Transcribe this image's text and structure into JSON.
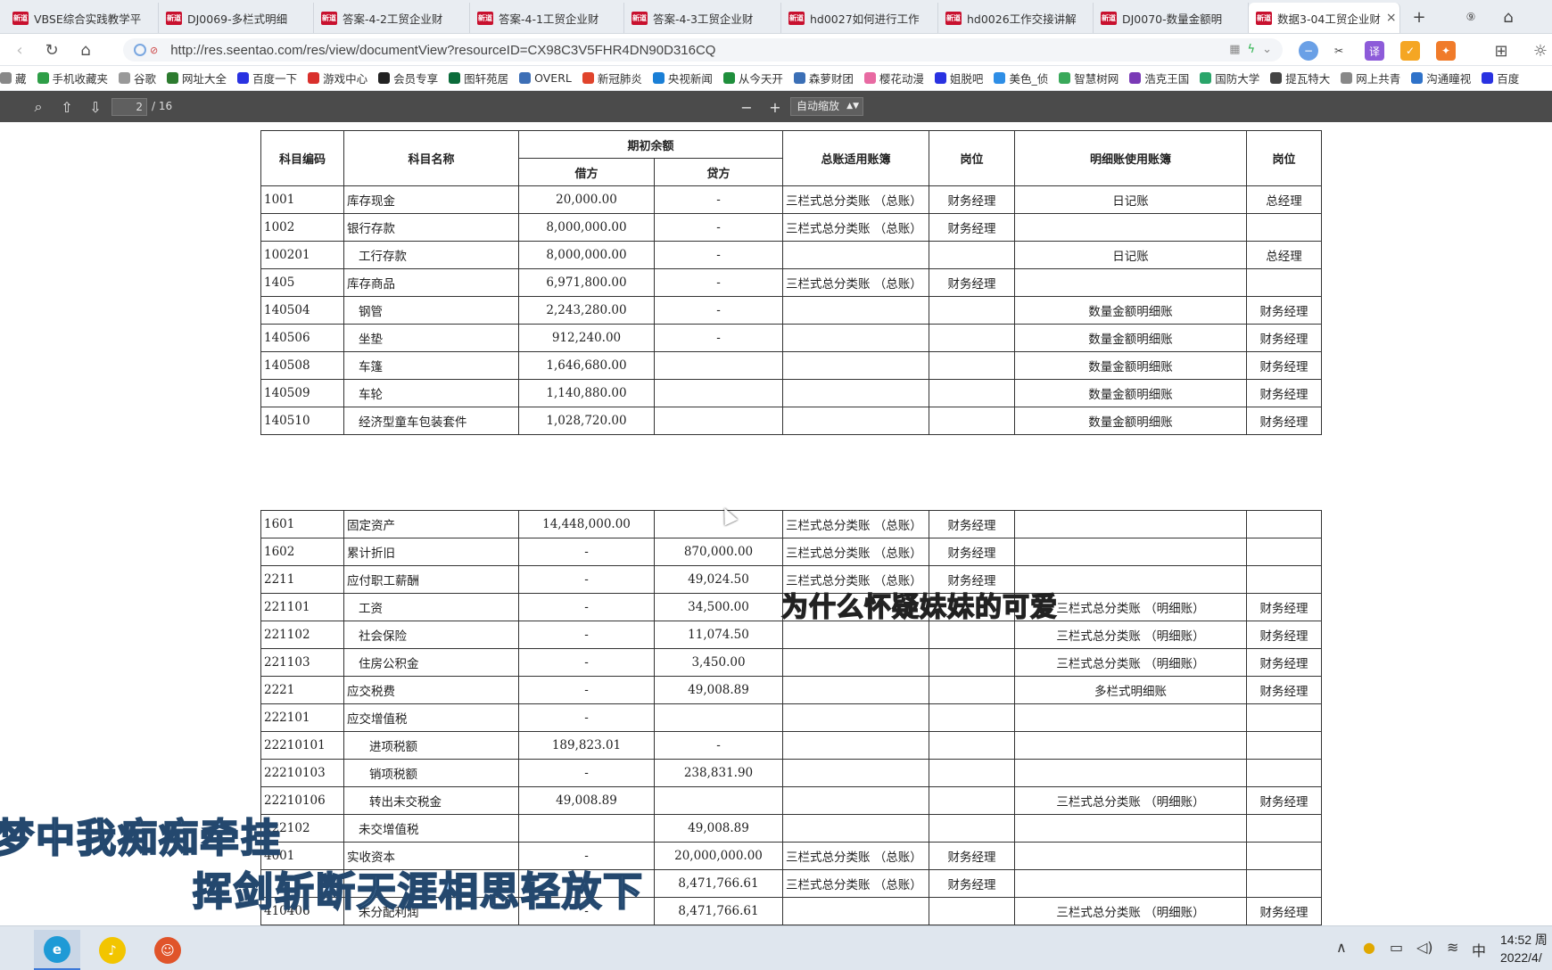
{
  "tabs": [
    {
      "label": "VBSE综合实践教学平",
      "active": false
    },
    {
      "label": "DJ0069-多栏式明细",
      "active": false
    },
    {
      "label": "答案-4-2工贸企业财",
      "active": false
    },
    {
      "label": "答案-4-1工贸企业财",
      "active": false
    },
    {
      "label": "答案-4-3工贸企业财",
      "active": false
    },
    {
      "label": "hd0027如何进行工作",
      "active": false
    },
    {
      "label": "hd0026工作交接讲解",
      "active": false
    },
    {
      "label": "DJ0070-数量金额明",
      "active": false
    },
    {
      "label": "数据3-04工贸企业财",
      "active": true
    }
  ],
  "favicon_text": "新道",
  "address": {
    "url": "http://res.seentao.com/res/view/documentView?resourceID=CX98C3V5FHR4DN90D316CQ"
  },
  "bookmarks": [
    {
      "label": "藏",
      "color": "#888888"
    },
    {
      "label": "手机收藏夹",
      "color": "#2e9e47"
    },
    {
      "label": "谷歌",
      "color": "#999999"
    },
    {
      "label": "网址大全",
      "color": "#2d7b2f"
    },
    {
      "label": "百度一下",
      "color": "#2932e1"
    },
    {
      "label": "游戏中心",
      "color": "#d9302c"
    },
    {
      "label": "会员专享",
      "color": "#222222"
    },
    {
      "label": "图轩苑居",
      "color": "#0b6b3a"
    },
    {
      "label": "OVERL",
      "color": "#3d6fb6"
    },
    {
      "label": "新冠肺炎",
      "color": "#e0442c"
    },
    {
      "label": "央视新闻",
      "color": "#1a7fd6"
    },
    {
      "label": "从今天开",
      "color": "#1f8f3c"
    },
    {
      "label": "森萝财团",
      "color": "#3b6fb6"
    },
    {
      "label": "樱花动漫",
      "color": "#e86aa2"
    },
    {
      "label": "姐脱吧",
      "color": "#2932e1"
    },
    {
      "label": "美色_侦",
      "color": "#2e8ee6"
    },
    {
      "label": "智慧树网",
      "color": "#3aa95a"
    },
    {
      "label": "浩克王国",
      "color": "#7a3ab6"
    },
    {
      "label": "国防大学",
      "color": "#2aa56a"
    },
    {
      "label": "提瓦特大",
      "color": "#444444"
    },
    {
      "label": "网上共青",
      "color": "#888888"
    },
    {
      "label": "沟通瞳视",
      "color": "#2f72c9"
    },
    {
      "label": "百度",
      "color": "#2932e1"
    }
  ],
  "pdf": {
    "page": "2",
    "total": "/ 16",
    "zoom": "自动缩放"
  },
  "table_headers": {
    "code": "科目编码",
    "name": "科目名称",
    "opening": "期初余额",
    "debit": "借方",
    "credit": "贷方",
    "gl_book": "总账适用账簿",
    "post1": "岗位",
    "sub_book": "明细账使用账簿",
    "post2": "岗位"
  },
  "rows_top": [
    {
      "code": "1001",
      "name": "库存现金",
      "indent": 0,
      "debit": "20,000.00",
      "credit": "-",
      "gl": "三栏式总分类账 （总账）",
      "post1": "财务经理",
      "sub": "日记账",
      "post2": "总经理"
    },
    {
      "code": "1002",
      "name": "银行存款",
      "indent": 0,
      "debit": "8,000,000.00",
      "credit": "-",
      "gl": "三栏式总分类账 （总账）",
      "post1": "财务经理",
      "sub": "",
      "post2": ""
    },
    {
      "code": "100201",
      "name": "工行存款",
      "indent": 1,
      "debit": "8,000,000.00",
      "credit": "-",
      "gl": "",
      "post1": "",
      "sub": "日记账",
      "post2": "总经理"
    },
    {
      "code": "1405",
      "name": "库存商品",
      "indent": 0,
      "debit": "6,971,800.00",
      "credit": "-",
      "gl": "三栏式总分类账 （总账）",
      "post1": "财务经理",
      "sub": "",
      "post2": ""
    },
    {
      "code": "140504",
      "name": "钢管",
      "indent": 1,
      "debit": "2,243,280.00",
      "credit": "-",
      "gl": "",
      "post1": "",
      "sub": "数量金额明细账",
      "post2": "财务经理"
    },
    {
      "code": "140506",
      "name": "坐垫",
      "indent": 1,
      "debit": "912,240.00",
      "credit": "-",
      "gl": "",
      "post1": "",
      "sub": "数量金额明细账",
      "post2": "财务经理"
    },
    {
      "code": "140508",
      "name": "车篷",
      "indent": 1,
      "debit": "1,646,680.00",
      "credit": "",
      "gl": "",
      "post1": "",
      "sub": "数量金额明细账",
      "post2": "财务经理"
    },
    {
      "code": "140509",
      "name": "车轮",
      "indent": 1,
      "debit": "1,140,880.00",
      "credit": "",
      "gl": "",
      "post1": "",
      "sub": "数量金额明细账",
      "post2": "财务经理"
    },
    {
      "code": "140510",
      "name": "经济型童车包装套件",
      "indent": 1,
      "debit": "1,028,720.00",
      "credit": "",
      "gl": "",
      "post1": "",
      "sub": "数量金额明细账",
      "post2": "财务经理"
    }
  ],
  "rows_bottom": [
    {
      "code": "1601",
      "name": "固定资产",
      "indent": 0,
      "debit": "14,448,000.00",
      "credit": "",
      "gl": "三栏式总分类账 （总账）",
      "post1": "财务经理",
      "sub": "",
      "post2": ""
    },
    {
      "code": "1602",
      "name": "累计折旧",
      "indent": 0,
      "debit": "-",
      "credit": "870,000.00",
      "gl": "三栏式总分类账 （总账）",
      "post1": "财务经理",
      "sub": "",
      "post2": ""
    },
    {
      "code": "2211",
      "name": "应付职工薪酬",
      "indent": 0,
      "debit": "-",
      "credit": "49,024.50",
      "gl": "三栏式总分类账 （总账）",
      "post1": "财务经理",
      "sub": "",
      "post2": ""
    },
    {
      "code": "221101",
      "name": "工资",
      "indent": 1,
      "debit": "-",
      "credit": "34,500.00",
      "gl": "",
      "post1": "",
      "sub": "三栏式总分类账 （明细账）",
      "post2": "财务经理"
    },
    {
      "code": "221102",
      "name": "社会保险",
      "indent": 1,
      "debit": "-",
      "credit": "11,074.50",
      "gl": "",
      "post1": "",
      "sub": "三栏式总分类账 （明细账）",
      "post2": "财务经理"
    },
    {
      "code": "221103",
      "name": "住房公积金",
      "indent": 1,
      "debit": "-",
      "credit": "3,450.00",
      "gl": "",
      "post1": "",
      "sub": "三栏式总分类账 （明细账）",
      "post2": "财务经理"
    },
    {
      "code": "2221",
      "name": "应交税费",
      "indent": 0,
      "debit": "-",
      "credit": "49,008.89",
      "gl": "",
      "post1": "",
      "sub": "多栏式明细账",
      "post2": "财务经理"
    },
    {
      "code": "222101",
      "name": "应交增值税",
      "indent": 0,
      "debit": "-",
      "credit": "",
      "gl": "",
      "post1": "",
      "sub": "",
      "post2": ""
    },
    {
      "code": "22210101",
      "name": "进项税额",
      "indent": 2,
      "debit": "189,823.01",
      "credit": "-",
      "gl": "",
      "post1": "",
      "sub": "",
      "post2": ""
    },
    {
      "code": "22210103",
      "name": "销项税额",
      "indent": 2,
      "debit": "-",
      "credit": "238,831.90",
      "gl": "",
      "post1": "",
      "sub": "",
      "post2": ""
    },
    {
      "code": "22210106",
      "name": "转出未交税金",
      "indent": 2,
      "debit": "49,008.89",
      "credit": "",
      "gl": "",
      "post1": "",
      "sub": "三栏式总分类账 （明细账）",
      "post2": "财务经理"
    },
    {
      "code": "222102",
      "name": "未交增值税",
      "indent": 1,
      "debit": "",
      "credit": "49,008.89",
      "gl": "",
      "post1": "",
      "sub": "",
      "post2": ""
    },
    {
      "code": "4001",
      "name": "实收资本",
      "indent": 0,
      "debit": "-",
      "credit": "20,000,000.00",
      "gl": "三栏式总分类账 （总账）",
      "post1": "财务经理",
      "sub": "",
      "post2": ""
    },
    {
      "code": "",
      "name": "",
      "indent": 0,
      "debit": "",
      "credit": "8,471,766.61",
      "gl": "三栏式总分类账 （总账）",
      "post1": "财务经理",
      "sub": "",
      "post2": ""
    },
    {
      "code": "410406",
      "name": "未分配利润",
      "indent": 1,
      "debit": "-",
      "credit": "8,471,766.61",
      "gl": "",
      "post1": "",
      "sub": "三栏式总分类账 （明细账）",
      "post2": "财务经理"
    }
  ],
  "overlay": {
    "subtitle": "为什么怀疑妹妹的可爱",
    "lyric1": "梦中我痴痴牵挂",
    "lyric2": "挥剑斩断天涯相思轻放下"
  },
  "taskbar": {
    "apps": [
      {
        "icon": "ie-icon",
        "color": "#1e9ad6",
        "glyph": "e",
        "active": true
      },
      {
        "icon": "qq-music-icon",
        "color": "#f2c500",
        "glyph": "♪",
        "active": false
      },
      {
        "icon": "game-app-icon",
        "color": "#e0542a",
        "glyph": "☺",
        "active": false
      }
    ],
    "ime": "中",
    "time": "14:52 周",
    "date": "2022/4/"
  }
}
